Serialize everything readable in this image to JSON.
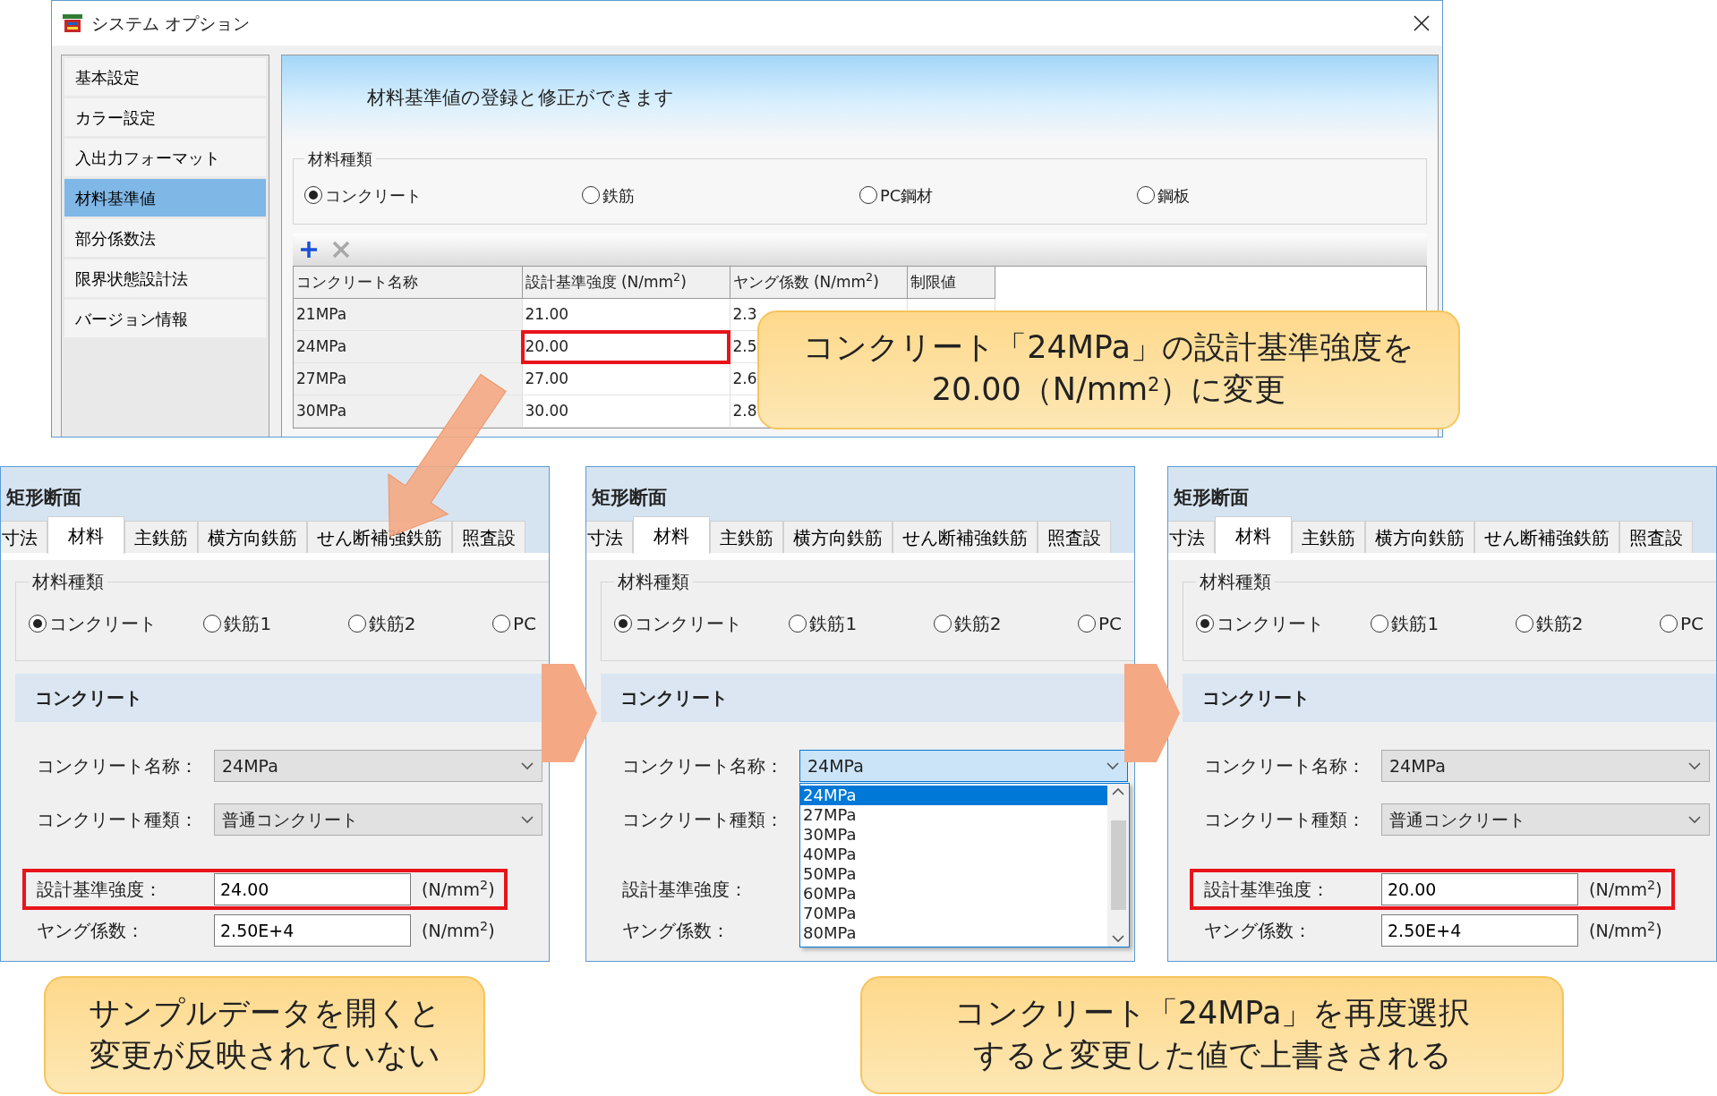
{
  "window": {
    "title": "システム オプション"
  },
  "sidebar": {
    "items": [
      {
        "label": "基本設定",
        "selected": false
      },
      {
        "label": "カラー設定",
        "selected": false
      },
      {
        "label": "入出力フォーマット",
        "selected": false
      },
      {
        "label": "材料基準値",
        "selected": true
      },
      {
        "label": "部分係数法",
        "selected": false
      },
      {
        "label": "限界状態設計法",
        "selected": false
      },
      {
        "label": "バージョン情報",
        "selected": false
      }
    ]
  },
  "banner": "材料基準値の登録と修正ができます",
  "material_type": {
    "legend": "材料種類",
    "options": [
      {
        "label": "コンクリート",
        "selected": true
      },
      {
        "label": "鉄筋",
        "selected": false
      },
      {
        "label": "PC鋼材",
        "selected": false
      },
      {
        "label": "鋼板",
        "selected": false
      }
    ]
  },
  "toolbar": {
    "buttons": [
      {
        "kind": "add",
        "disabled": false
      },
      {
        "kind": "delete",
        "disabled": true
      }
    ]
  },
  "table": {
    "columns": [
      "コンクリート名称",
      "設計基準強度 (N/mm$^{2}$)",
      "ヤング係数 (N/mm$^{2}$)",
      "制限値"
    ],
    "rows": [
      {
        "cells": [
          "21MPa",
          "21.00",
          "2.3"
        ],
        "highlighted": false
      },
      {
        "cells": [
          "24MPa",
          "20.00",
          "2.5"
        ],
        "highlighted": true
      },
      {
        "cells": [
          "27MPa",
          "27.00",
          "2.6"
        ],
        "highlighted": false
      },
      {
        "cells": [
          "30MPa",
          "30.00",
          "2.8"
        ],
        "highlighted": false
      }
    ]
  },
  "callouts": [
    {
      "lines": [
        "コンクリート「24MPa」の設計基準強度を",
        "20.00（N/mm$^{2}$）に変更"
      ]
    },
    {
      "lines": [
        "サンプルデータを開くと",
        "変更が反映されていない"
      ]
    },
    {
      "lines": [
        "コンクリート「24MPa」を再度選択",
        "すると変更した値で上書きされる"
      ]
    }
  ],
  "panels": [
    {
      "title": "矩形断面",
      "tabs": [
        {
          "label": "寸法",
          "selected": false
        },
        {
          "label": "材料",
          "selected": true
        },
        {
          "label": "主鉄筋",
          "selected": false
        },
        {
          "label": "横方向鉄筋",
          "selected": false
        },
        {
          "label": "せん断補強鉄筋",
          "selected": false
        },
        {
          "label": "照査設",
          "selected": false
        }
      ],
      "material_group": {
        "legend": "材料種類",
        "options": [
          {
            "label": "コンクリート",
            "selected": true
          },
          {
            "label": "鉄筋1",
            "selected": false
          },
          {
            "label": "鉄筋2",
            "selected": false
          },
          {
            "label": "PC",
            "selected": false
          }
        ]
      },
      "section": "コンクリート",
      "fields": [
        {
          "label": "コンクリート名称：",
          "kind": "select",
          "value": "24MPa",
          "focused": false
        },
        {
          "label": "コンクリート種類：",
          "kind": "select",
          "value": "普通コンクリート",
          "focused": false
        },
        {
          "label": "設計基準強度：",
          "kind": "input",
          "value": "24.00",
          "unit": "(N/mm$^{2}$)",
          "highlighted": true
        },
        {
          "label": "ヤング係数：",
          "kind": "input",
          "value": "2.50E+4",
          "unit": "(N/mm$^{2}$)",
          "highlighted": false
        }
      ]
    },
    {
      "title": "矩形断面",
      "tabs": [
        {
          "label": "寸法",
          "selected": false
        },
        {
          "label": "材料",
          "selected": true
        },
        {
          "label": "主鉄筋",
          "selected": false
        },
        {
          "label": "横方向鉄筋",
          "selected": false
        },
        {
          "label": "せん断補強鉄筋",
          "selected": false
        },
        {
          "label": "照査設",
          "selected": false
        }
      ],
      "material_group": {
        "legend": "材料種類",
        "options": [
          {
            "label": "コンクリート",
            "selected": true
          },
          {
            "label": "鉄筋1",
            "selected": false
          },
          {
            "label": "鉄筋2",
            "selected": false
          },
          {
            "label": "PC",
            "selected": false
          }
        ]
      },
      "section": "コンクリート",
      "fields": [
        {
          "label": "コンクリート名称：",
          "kind": "select",
          "value": "24MPa",
          "focused": true,
          "dropdown": {
            "items": [
              {
                "label": "24MPa",
                "selected": true
              },
              {
                "label": "27MPa",
                "selected": false
              },
              {
                "label": "30MPa",
                "selected": false
              },
              {
                "label": "40MPa",
                "selected": false
              },
              {
                "label": "50MPa",
                "selected": false
              },
              {
                "label": "60MPa",
                "selected": false
              },
              {
                "label": "70MPa",
                "selected": false
              },
              {
                "label": "80MPa",
                "selected": false
              }
            ]
          }
        },
        {
          "label": "コンクリート種類：",
          "kind": "label"
        },
        {
          "label": "設計基準強度：",
          "kind": "label"
        },
        {
          "label": "ヤング係数：",
          "kind": "label"
        }
      ]
    },
    {
      "title": "矩形断面",
      "tabs": [
        {
          "label": "寸法",
          "selected": false
        },
        {
          "label": "材料",
          "selected": true
        },
        {
          "label": "主鉄筋",
          "selected": false
        },
        {
          "label": "横方向鉄筋",
          "selected": false
        },
        {
          "label": "せん断補強鉄筋",
          "selected": false
        },
        {
          "label": "照査設",
          "selected": false
        }
      ],
      "material_group": {
        "legend": "材料種類",
        "options": [
          {
            "label": "コンクリート",
            "selected": true
          },
          {
            "label": "鉄筋1",
            "selected": false
          },
          {
            "label": "鉄筋2",
            "selected": false
          },
          {
            "label": "PC",
            "selected": false
          }
        ]
      },
      "section": "コンクリート",
      "fields": [
        {
          "label": "コンクリート名称：",
          "kind": "select",
          "value": "24MPa",
          "focused": false
        },
        {
          "label": "コンクリート種類：",
          "kind": "select",
          "value": "普通コンクリート",
          "focused": false
        },
        {
          "label": "設計基準強度：",
          "kind": "input",
          "value": "20.00",
          "unit": "(N/mm$^{2}$)",
          "highlighted": true
        },
        {
          "label": "ヤング係数：",
          "kind": "input",
          "value": "2.50E+4",
          "unit": "(N/mm$^{2}$)",
          "highlighted": false
        }
      ]
    }
  ]
}
